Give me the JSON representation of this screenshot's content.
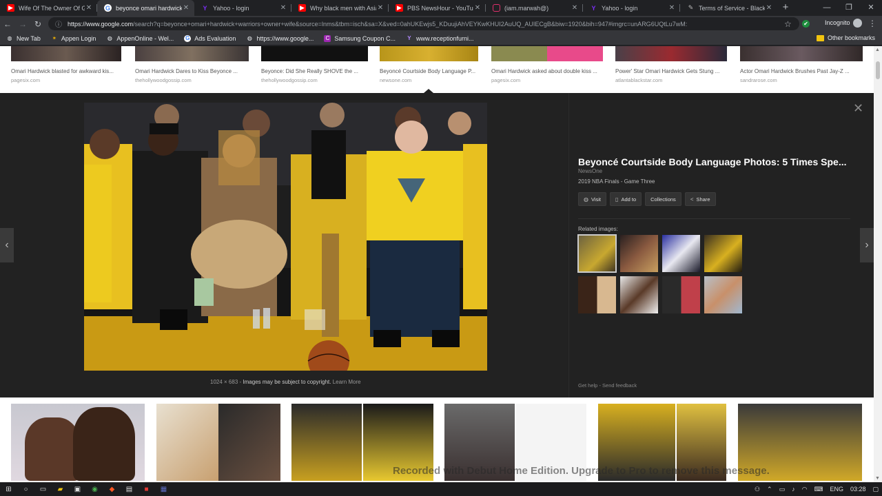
{
  "tabs": [
    {
      "title": "Wife Of The Owner Of Golden",
      "icon": "youtube-icon",
      "active": false
    },
    {
      "title": "beyonce omari hardwick warriors",
      "icon": "google-icon",
      "active": true
    },
    {
      "title": "Yahoo - login",
      "icon": "yahoo-icon",
      "active": false
    },
    {
      "title": "Why black men with Asian",
      "icon": "youtube-icon",
      "active": false
    },
    {
      "title": "PBS NewsHour - YouTube",
      "icon": "youtube-icon",
      "active": false
    },
    {
      "title": "(iam.marwah@)",
      "icon": "instagram-icon",
      "active": false
    },
    {
      "title": "Yahoo - login",
      "icon": "yahoo-icon",
      "active": false
    },
    {
      "title": "Terms of Service - BlackAm",
      "icon": "blackam-icon",
      "active": false
    }
  ],
  "new_tab_glyph": "+",
  "address": {
    "domain": "https://www.google.com",
    "path": "/search?q=beyonce+omari+hardwick+warriors+owner+wife&source=lnms&tbm=isch&sa=X&ved=0ahUKEwjs5_KDuujiAhVEYKwKHUI2AuUQ_AUIECgB&biw=1920&bih=947#imgrc=unARG6UQtLu7wM:"
  },
  "profile_label": "Incognito",
  "bookmarks": [
    {
      "label": "New Tab",
      "icon": "globe-icon"
    },
    {
      "label": "Appen Login",
      "icon": "appen-icon"
    },
    {
      "label": "AppenOnline - Wel...",
      "icon": "globe-icon"
    },
    {
      "label": "Ads Evaluation",
      "icon": "google-icon"
    },
    {
      "label": "https://www.google...",
      "icon": "globe-icon"
    },
    {
      "label": "Samsung Coupon C...",
      "icon": "coupon-icon"
    },
    {
      "label": "www.receptionfurni...",
      "icon": "yahoo-icon"
    }
  ],
  "other_bookmarks": "Other bookmarks",
  "top_results": [
    {
      "caption": "Omari Hardwick blasted for awkward kis...",
      "source": "pagesix.com"
    },
    {
      "caption": "Omari Hardwick Dares to Kiss Beyonce ...",
      "source": "thehollywoodgossip.com"
    },
    {
      "caption": "Beyonce: Did She Really SHOVE the ...",
      "source": "thehollywoodgossip.com"
    },
    {
      "caption": "Beyoncé Courtside Body Language P...",
      "source": "newsone.com"
    },
    {
      "caption": "Omari Hardwick asked about double kiss ...",
      "source": "pagesix.com"
    },
    {
      "caption": "Power' Star Omari Hardwick Gets Stung ...",
      "source": "atlantablackstar.com"
    },
    {
      "caption": "Actor Omari Hardwick Brushes Past Jay-Z ...",
      "source": "sandrarose.com"
    }
  ],
  "panel": {
    "title": "Beyoncé Courtside Body Language Photos: 5 Times Spe...",
    "source": "NewsOne",
    "description": "2019 NBA Finals - Game Three",
    "buttons": [
      {
        "label": "Visit",
        "icon": "globe-icon"
      },
      {
        "label": "Add to",
        "icon": "bookmark-icon"
      },
      {
        "label": "Collections",
        "icon": ""
      },
      {
        "label": "Share",
        "icon": "share-icon"
      }
    ],
    "related_label": "Related images:",
    "image_size": "1024 × 683",
    "copyright": "Images may be subject to copyright.",
    "learn_more": "Learn More",
    "get_help": "Get help",
    "separator": "-",
    "send_feedback": "Send feedback",
    "close_glyph": "✕",
    "prev_glyph": "‹",
    "next_glyph": "›"
  },
  "watermark": "Recorded with Debut Home Edition. Upgrade to Pro to remove this message.",
  "taskbar": {
    "language": "ENG",
    "time": "03:28"
  },
  "colors": {
    "court_yellow": "#c8a520",
    "panel_bg": "#222222",
    "youtube_red": "#ff0000",
    "yahoo_purple": "#7b2ff7"
  }
}
